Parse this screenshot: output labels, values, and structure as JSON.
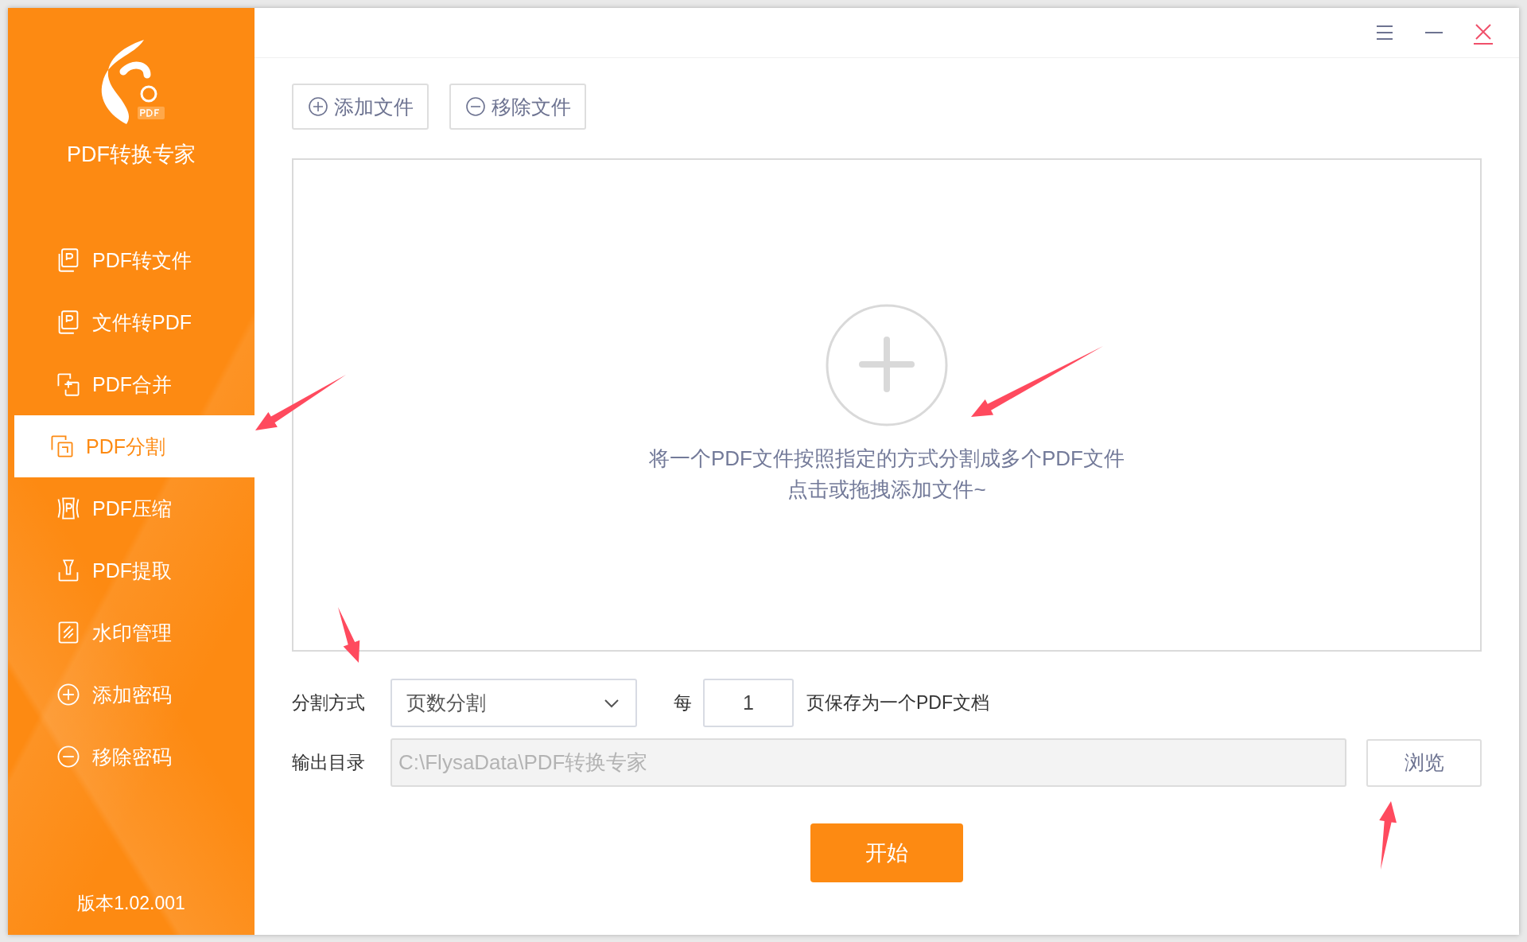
{
  "app": {
    "name": "PDF转换专家",
    "version": "版本1.02.001"
  },
  "nav": [
    {
      "label": "PDF转文件",
      "kind": "document",
      "selected": false
    },
    {
      "label": "文件转PDF",
      "kind": "document",
      "selected": false
    },
    {
      "label": "PDF合并",
      "kind": "merge",
      "selected": false
    },
    {
      "label": "PDF分割",
      "kind": "split",
      "selected": true
    },
    {
      "label": "PDF压缩",
      "kind": "compress",
      "selected": false
    },
    {
      "label": "PDF提取",
      "kind": "extract",
      "selected": false
    },
    {
      "label": "水印管理",
      "kind": "watermark",
      "selected": false
    },
    {
      "label": "添加密码",
      "kind": "add",
      "selected": false
    },
    {
      "label": "移除密码",
      "kind": "remove",
      "selected": false
    }
  ],
  "toolbar": [
    {
      "label": "添加文件",
      "kind": "add"
    },
    {
      "label": "移除文件",
      "kind": "remove"
    }
  ],
  "drop_zone": {
    "line_1": "将一个PDF文件按照指定的方式分割成多个PDF文件",
    "line_2": "点击或拖拽添加文件~"
  },
  "split": {
    "label": "分割方式",
    "mode": "页数分割",
    "prefix": "每",
    "pages": "1",
    "suffix": "页保存为一个PDF文档"
  },
  "output": {
    "label": "输出目录",
    "path": "C:\\FlysaData\\PDF转换专家",
    "browse": "浏览"
  },
  "start": "开始"
}
